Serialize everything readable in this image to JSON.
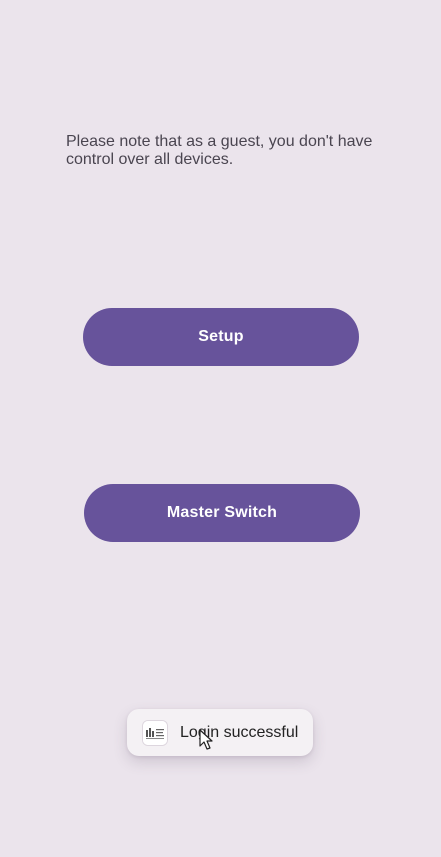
{
  "screen": {
    "guest_note": "Please note that as a guest, you don't have control over all devices."
  },
  "buttons": {
    "setup_label": "Setup",
    "master_switch_label": "Master Switch"
  },
  "toast": {
    "message": "Login successful",
    "icon": "app-logo-icon"
  },
  "colors": {
    "background": "#EBE4EC",
    "button": "#67539B",
    "button_text": "#FFFFFF",
    "toast_bg": "#F4F1F4"
  }
}
